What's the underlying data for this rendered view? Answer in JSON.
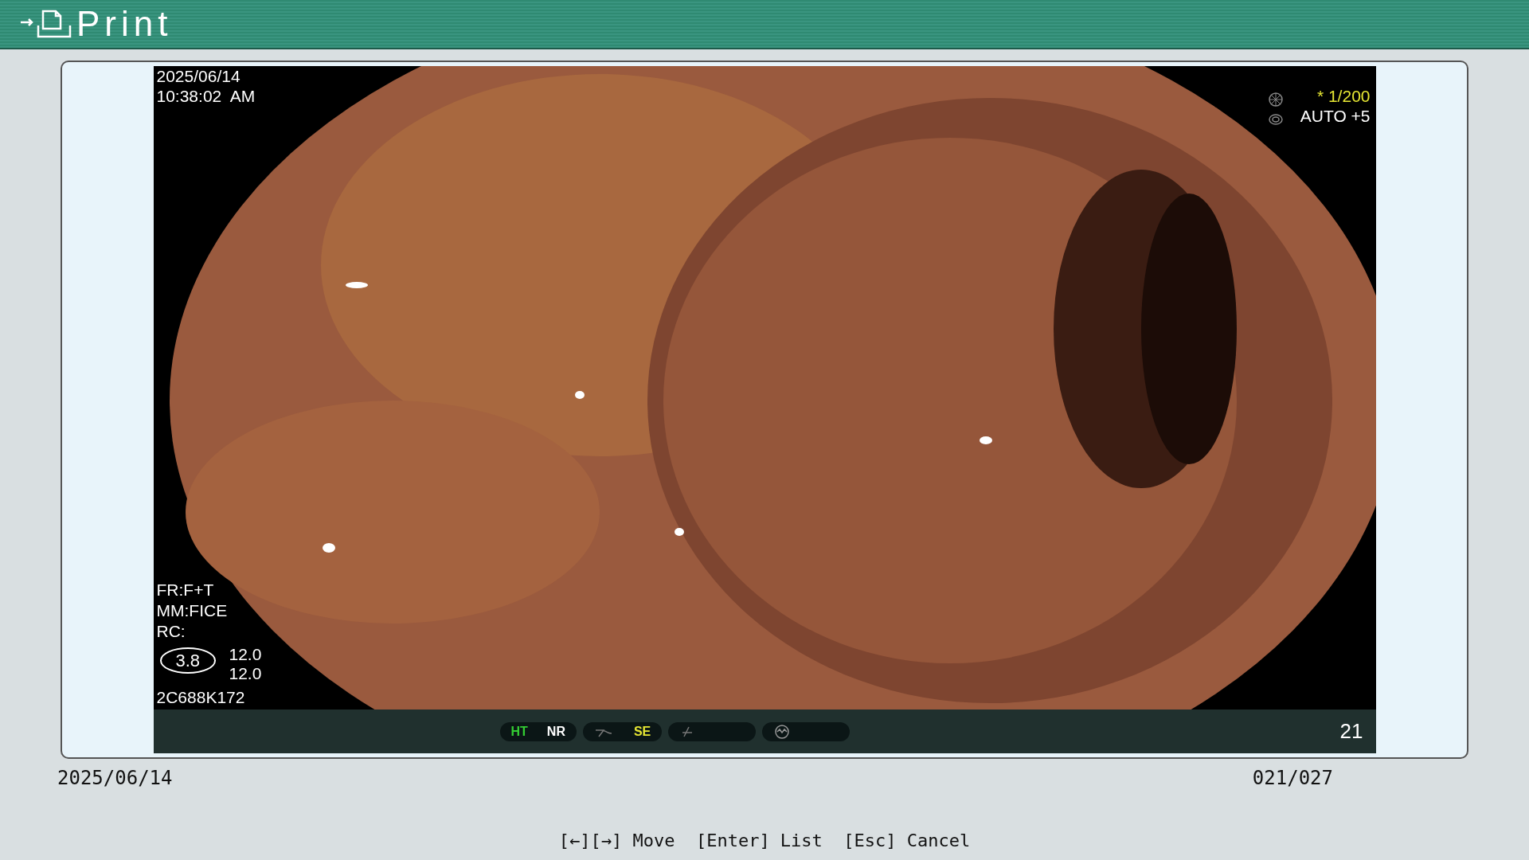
{
  "header": {
    "title": "Print"
  },
  "image": {
    "kind": "picture",
    "date": "2025/06/14",
    "time": "10:38:02  AM",
    "shutter": "* 1/200",
    "iris": "AUTO +5",
    "settings": [
      "FR:F+T",
      "MM:FICE",
      "RC:"
    ],
    "zoom": "3.8",
    "values": [
      "12.0",
      "12.0"
    ],
    "serial": "2C688K172",
    "frame_number": "21",
    "indicators": [
      {
        "kind": "text",
        "labels": [
          {
            "text": "HT",
            "color": "#33cc33"
          },
          {
            "text": "NR",
            "color": "#ffffff"
          }
        ]
      },
      {
        "kind": "icon_text",
        "labels": [
          {
            "text": "SE",
            "color": "#e6e633"
          }
        ]
      },
      {
        "kind": "icon"
      },
      {
        "kind": "icon"
      }
    ]
  },
  "footer": {
    "date": "2025/06/14",
    "counter": "021/027"
  },
  "hint": "[←][→] Move  [Enter] List  [Esc] Cancel"
}
